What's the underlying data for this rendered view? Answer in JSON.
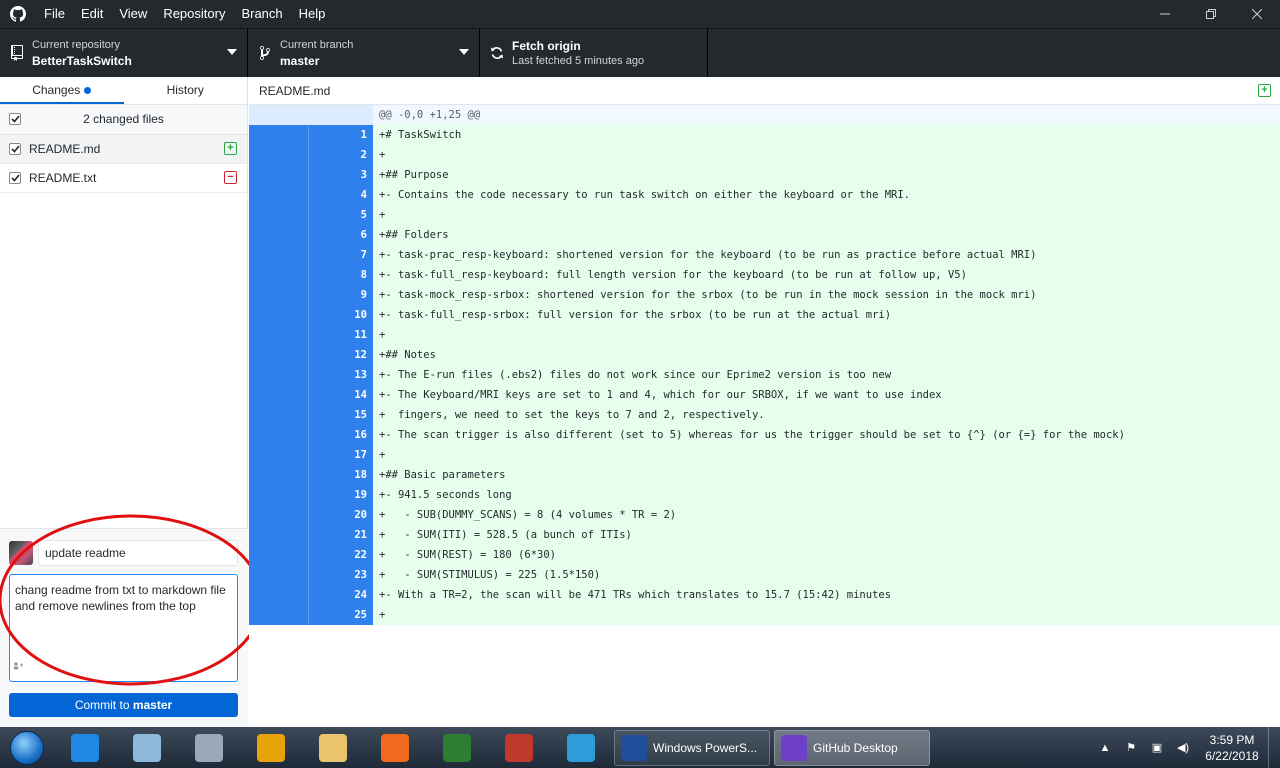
{
  "menu": [
    "File",
    "Edit",
    "View",
    "Repository",
    "Branch",
    "Help"
  ],
  "toolbar": {
    "repo_label": "Current repository",
    "repo_value": "BetterTaskSwitch",
    "branch_label": "Current branch",
    "branch_value": "master",
    "fetch_label": "Fetch origin",
    "fetch_sub": "Last fetched 5 minutes ago"
  },
  "tabs": {
    "changes": "Changes",
    "history": "History"
  },
  "changes": {
    "header": "2 changed files",
    "files": [
      {
        "name": "README.md",
        "status": "added",
        "symbol": "+"
      },
      {
        "name": "README.txt",
        "status": "removed",
        "symbol": "−"
      }
    ]
  },
  "commit": {
    "summary": "update readme",
    "description": "chang readme from txt to markdown file and remove newlines from the top",
    "button_prefix": "Commit to ",
    "button_branch": "master"
  },
  "diff": {
    "filename": "README.md",
    "hunk": "@@ -0,0 +1,25 @@",
    "lines": [
      {
        "n": "1",
        "t": "+# TaskSwitch",
        "style": "hl"
      },
      {
        "n": "2",
        "t": "+",
        "style": ""
      },
      {
        "n": "3",
        "t": "+## Purpose",
        "style": "hl"
      },
      {
        "n": "4",
        "t": "+- Contains the code necessary to run task switch on either the keyboard or the MRI.",
        "style": ""
      },
      {
        "n": "5",
        "t": "+",
        "style": ""
      },
      {
        "n": "6",
        "t": "+## Folders",
        "style": "hl"
      },
      {
        "n": "7",
        "t": "+- task-prac_resp-keyboard: shortened version for the keyboard (to be run as practice before actual MRI)",
        "style": ""
      },
      {
        "n": "8",
        "t": "+- task-full_resp-keyboard: full length version for the keyboard (to be run at follow up, V5)",
        "style": ""
      },
      {
        "n": "9",
        "t": "+- task-mock_resp-srbox: shortened version for the srbox (to be run in the mock session in the mock mri)",
        "style": ""
      },
      {
        "n": "10",
        "t": "+- task-full_resp-srbox: full version for the srbox (to be run at the actual mri)",
        "style": ""
      },
      {
        "n": "11",
        "t": "+",
        "style": ""
      },
      {
        "n": "12",
        "t": "+## Notes",
        "style": "hl"
      },
      {
        "n": "13",
        "t": "+- The E-run files (.ebs2) files do not work since our Eprime2 version is too new",
        "style": ""
      },
      {
        "n": "14",
        "t": "+- The Keyboard/MRI keys are set to 1 and 4, which for our SRBOX, if we want to use index",
        "style": ""
      },
      {
        "n": "15",
        "t": "+  fingers, we need to set the keys to 7 and 2, respectively.",
        "style": ""
      },
      {
        "n": "16",
        "t": "+- The scan trigger is also different (set to 5) whereas for us the trigger should be set to {^} (or {=} for the mock)",
        "style": ""
      },
      {
        "n": "17",
        "t": "+",
        "style": ""
      },
      {
        "n": "18",
        "t": "+## Basic parameters",
        "style": "hl"
      },
      {
        "n": "19",
        "t": "+- 941.5 seconds long",
        "style": ""
      },
      {
        "n": "20",
        "t": "+   - SUB(DUMMY_SCANS) = 8 (4 volumes * TR = 2)",
        "style": ""
      },
      {
        "n": "21",
        "t": "+   - SUM(ITI) = 528.5 (a bunch of ITIs)",
        "style": ""
      },
      {
        "n": "22",
        "t": "+   - SUM(REST) = 180 (6*30)",
        "style": ""
      },
      {
        "n": "23",
        "t": "+   - SUM(STIMULUS) = 225 (1.5*150)",
        "style": ""
      },
      {
        "n": "24",
        "t": "+- With a TR=2, the scan will be 471 TRs which translates to 15.7 (15:42) minutes",
        "style": ""
      },
      {
        "n": "25",
        "t": "+",
        "style": ""
      }
    ]
  },
  "taskbar": {
    "windows": [
      {
        "label": "Windows PowerS...",
        "icon": "powershell-icon",
        "color": "#1f4e9c"
      },
      {
        "label": "GitHub Desktop",
        "icon": "github-desktop-icon",
        "color": "#6e40c9"
      }
    ],
    "pinned": [
      {
        "icon": "internet-explorer-icon",
        "color": "#1e88e5"
      },
      {
        "icon": "notepad-icon",
        "color": "#8fb8d8"
      },
      {
        "icon": "calculator-icon",
        "color": "#9aa9b8"
      },
      {
        "icon": "chrome-icon",
        "color": "#e8a20a"
      },
      {
        "icon": "file-explorer-icon",
        "color": "#e9c46a"
      },
      {
        "icon": "firefox-icon",
        "color": "#f06a1d"
      },
      {
        "icon": "eprime-icon",
        "color": "#2e7d32"
      },
      {
        "icon": "avatar-app-icon",
        "color": "#c0392b"
      },
      {
        "icon": "fx-icon",
        "color": "#2d9cdb"
      }
    ],
    "time": "3:59 PM",
    "date": "6/22/2018"
  }
}
